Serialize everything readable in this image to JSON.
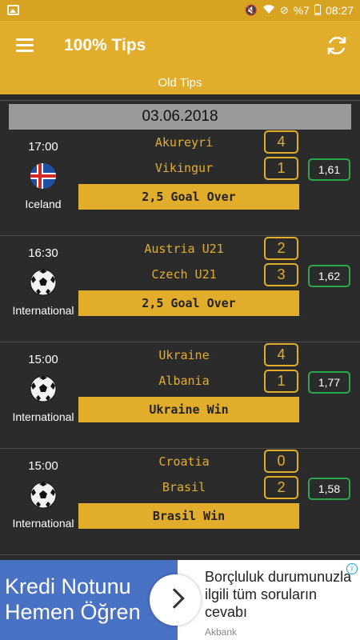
{
  "status_bar": {
    "battery": "%7",
    "time": "08:27"
  },
  "app_bar": {
    "title": "100% Tips"
  },
  "sub_bar": {
    "label": "Old Tips"
  },
  "date": "03.06.2018",
  "matches": [
    {
      "time": "17:00",
      "country": "Iceland",
      "icon": "iceland-flag-icon",
      "home": "Akureyri",
      "away": "Vikingur",
      "home_score": "4",
      "away_score": "1",
      "tip": "2,5 Goal Over",
      "odd": "1,61"
    },
    {
      "time": "16:30",
      "country": "International",
      "icon": "soccer-ball-icon",
      "home": "Austria U21",
      "away": "Czech U21",
      "home_score": "2",
      "away_score": "3",
      "tip": "2,5 Goal Over",
      "odd": "1,62"
    },
    {
      "time": "15:00",
      "country": "International",
      "icon": "soccer-ball-icon",
      "home": "Ukraine",
      "away": "Albania",
      "home_score": "4",
      "away_score": "1",
      "tip": "Ukraine Win",
      "odd": "1,77"
    },
    {
      "time": "15:00",
      "country": "International",
      "icon": "soccer-ball-icon",
      "home": "Croatia",
      "away": "Brasil",
      "home_score": "0",
      "away_score": "2",
      "tip": "Brasil Win",
      "odd": "1,58"
    }
  ],
  "ad": {
    "left_line1": "Kredi Notunu",
    "left_line2": "Hemen Öğren",
    "text": "Borçluluk durumunuzla ilgili tüm soruların cevabı",
    "brand": "Akbank",
    "info": "i"
  },
  "colors": {
    "accent": "#e3ad2c",
    "odd_border": "#2aa84a",
    "background": "#2b2b2b",
    "ad_blue": "#4a72c4"
  }
}
